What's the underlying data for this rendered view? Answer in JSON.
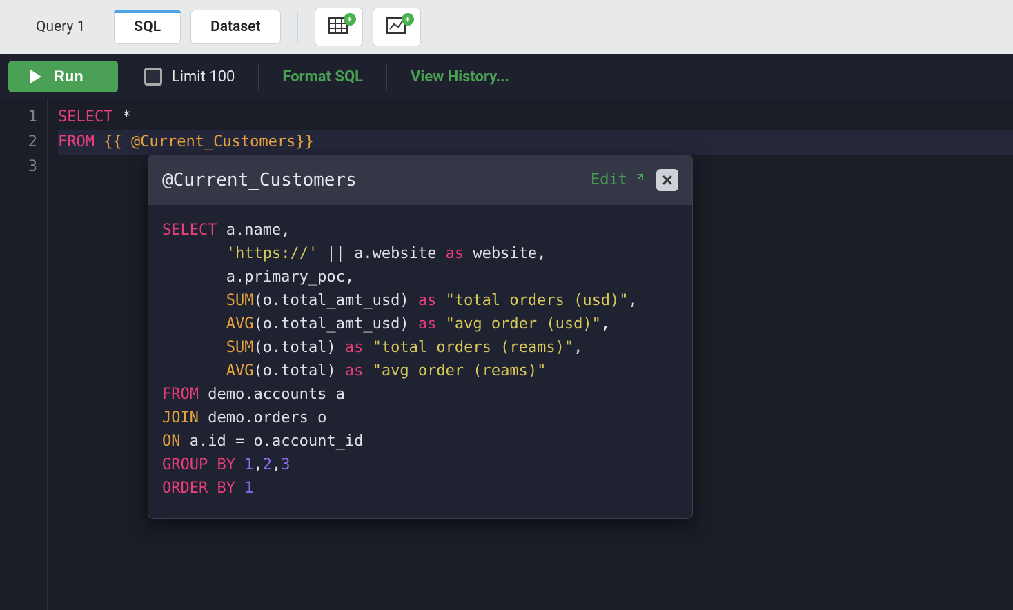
{
  "top_tabs": {
    "query_tab": "Query 1",
    "tabs": [
      {
        "label": "SQL",
        "active": true
      },
      {
        "label": "Dataset",
        "active": false
      }
    ],
    "icon_btns": [
      {
        "name": "add-table-icon"
      },
      {
        "name": "add-chart-icon"
      }
    ]
  },
  "toolbar": {
    "run_label": "Run",
    "limit_label": "Limit 100",
    "format_label": "Format SQL",
    "history_label": "View History..."
  },
  "editor": {
    "gutter": [
      "1",
      "2",
      "3"
    ],
    "lines": [
      {
        "segments": [
          {
            "t": "SELECT",
            "c": "kw-pink"
          },
          {
            "t": " *",
            "c": "ident"
          }
        ]
      },
      {
        "hl": true,
        "segments": [
          {
            "t": "FROM",
            "c": "kw-pink"
          },
          {
            "t": " {{ ",
            "c": "kw-orange"
          },
          {
            "t": "@Current_Customers",
            "c": "kw-orange"
          },
          {
            "t": "}}",
            "c": "kw-orange"
          }
        ]
      },
      {
        "segments": []
      }
    ]
  },
  "popup": {
    "title": "@Current_Customers",
    "edit_label": "Edit",
    "body_lines": [
      [
        {
          "t": "SELECT",
          "c": "kw-pink"
        },
        {
          "t": " a.name,",
          "c": "ident"
        }
      ],
      [
        {
          "t": "       ",
          "c": "ident"
        },
        {
          "t": "'https://'",
          "c": "str-yellow"
        },
        {
          "t": " || a.website ",
          "c": "ident"
        },
        {
          "t": "as",
          "c": "kw-pink"
        },
        {
          "t": " website,",
          "c": "ident"
        }
      ],
      [
        {
          "t": "       a.primary_poc,",
          "c": "ident"
        }
      ],
      [
        {
          "t": "       ",
          "c": "ident"
        },
        {
          "t": "SUM",
          "c": "kw-orange"
        },
        {
          "t": "(o.total_amt_usd) ",
          "c": "ident"
        },
        {
          "t": "as",
          "c": "kw-pink"
        },
        {
          "t": " ",
          "c": "ident"
        },
        {
          "t": "\"total orders (usd)\"",
          "c": "str-yellow"
        },
        {
          "t": ",",
          "c": "ident"
        }
      ],
      [
        {
          "t": "       ",
          "c": "ident"
        },
        {
          "t": "AVG",
          "c": "kw-orange"
        },
        {
          "t": "(o.total_amt_usd) ",
          "c": "ident"
        },
        {
          "t": "as",
          "c": "kw-pink"
        },
        {
          "t": " ",
          "c": "ident"
        },
        {
          "t": "\"avg order (usd)\"",
          "c": "str-yellow"
        },
        {
          "t": ",",
          "c": "ident"
        }
      ],
      [
        {
          "t": "       ",
          "c": "ident"
        },
        {
          "t": "SUM",
          "c": "kw-orange"
        },
        {
          "t": "(o.total) ",
          "c": "ident"
        },
        {
          "t": "as",
          "c": "kw-pink"
        },
        {
          "t": " ",
          "c": "ident"
        },
        {
          "t": "\"total orders (reams)\"",
          "c": "str-yellow"
        },
        {
          "t": ",",
          "c": "ident"
        }
      ],
      [
        {
          "t": "       ",
          "c": "ident"
        },
        {
          "t": "AVG",
          "c": "kw-orange"
        },
        {
          "t": "(o.total) ",
          "c": "ident"
        },
        {
          "t": "as",
          "c": "kw-pink"
        },
        {
          "t": " ",
          "c": "ident"
        },
        {
          "t": "\"avg order (reams)\"",
          "c": "str-yellow"
        }
      ],
      [
        {
          "t": "FROM",
          "c": "kw-pink"
        },
        {
          "t": " demo.accounts a",
          "c": "ident"
        }
      ],
      [
        {
          "t": "JOIN",
          "c": "kw-orange"
        },
        {
          "t": " demo.orders o",
          "c": "ident"
        }
      ],
      [
        {
          "t": "ON",
          "c": "kw-orange"
        },
        {
          "t": " a.id = o.account_id",
          "c": "ident"
        }
      ],
      [
        {
          "t": "GROUP BY",
          "c": "kw-pink"
        },
        {
          "t": " ",
          "c": "ident"
        },
        {
          "t": "1",
          "c": "kw-purple"
        },
        {
          "t": ",",
          "c": "ident"
        },
        {
          "t": "2",
          "c": "kw-purple"
        },
        {
          "t": ",",
          "c": "ident"
        },
        {
          "t": "3",
          "c": "kw-purple"
        }
      ],
      [
        {
          "t": "ORDER BY",
          "c": "kw-pink"
        },
        {
          "t": " ",
          "c": "ident"
        },
        {
          "t": "1",
          "c": "kw-purple"
        }
      ]
    ]
  }
}
